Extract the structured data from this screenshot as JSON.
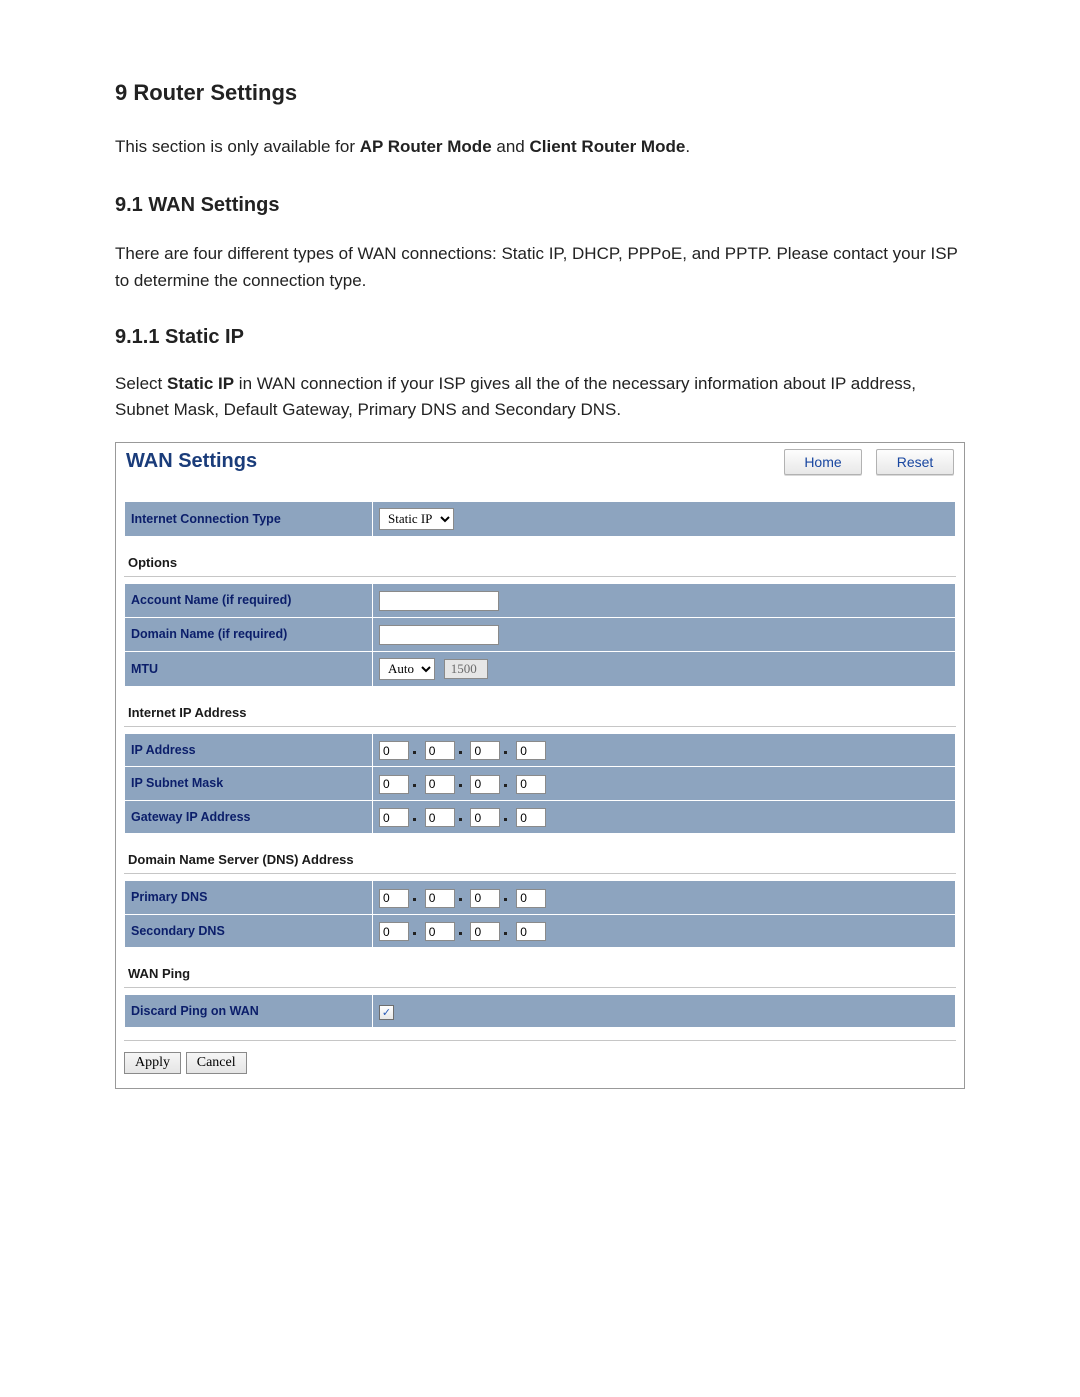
{
  "headings": {
    "h1": "9 Router Settings",
    "h2": "9.1 WAN Settings",
    "h3": "9.1.1 Static IP"
  },
  "intro": {
    "p1_pre": "This section is only available for ",
    "p1_b1": "AP Router Mode",
    "p1_mid": " and ",
    "p1_b2": "Client Router Mode",
    "p1_post": ".",
    "p2": "There are four different types of WAN connections: Static IP, DHCP, PPPoE, and PPTP. Please contact your ISP to determine the connection type.",
    "p3_pre": "Select ",
    "p3_b": "Static IP",
    "p3_post": " in WAN connection if your ISP gives all the of the necessary information about IP address, Subnet Mask, Default Gateway, Primary DNS and Secondary DNS."
  },
  "panel": {
    "title": "WAN Settings",
    "home": "Home",
    "reset": "Reset",
    "connection_type_label": "Internet Connection Type",
    "connection_type_value": "Static IP",
    "sections": {
      "options": "Options",
      "internet_ip": "Internet IP Address",
      "dns": "Domain Name Server (DNS) Address",
      "wan_ping": "WAN Ping"
    },
    "options": {
      "account_label": "Account Name (if required)",
      "account_value": "",
      "domain_label": "Domain Name (if required)",
      "domain_value": "",
      "mtu_label": "MTU",
      "mtu_mode": "Auto",
      "mtu_value": "1500"
    },
    "ip": {
      "ip_label": "IP Address",
      "subnet_label": "IP Subnet Mask",
      "gateway_label": "Gateway IP Address",
      "ip_octets": [
        "0",
        "0",
        "0",
        "0"
      ],
      "subnet_octets": [
        "0",
        "0",
        "0",
        "0"
      ],
      "gateway_octets": [
        "0",
        "0",
        "0",
        "0"
      ]
    },
    "dns": {
      "primary_label": "Primary DNS",
      "secondary_label": "Secondary DNS",
      "primary_octets": [
        "0",
        "0",
        "0",
        "0"
      ],
      "secondary_octets": [
        "0",
        "0",
        "0",
        "0"
      ]
    },
    "ping": {
      "discard_label": "Discard Ping on WAN",
      "checked": "✓"
    },
    "buttons": {
      "apply": "Apply",
      "cancel": "Cancel"
    }
  }
}
